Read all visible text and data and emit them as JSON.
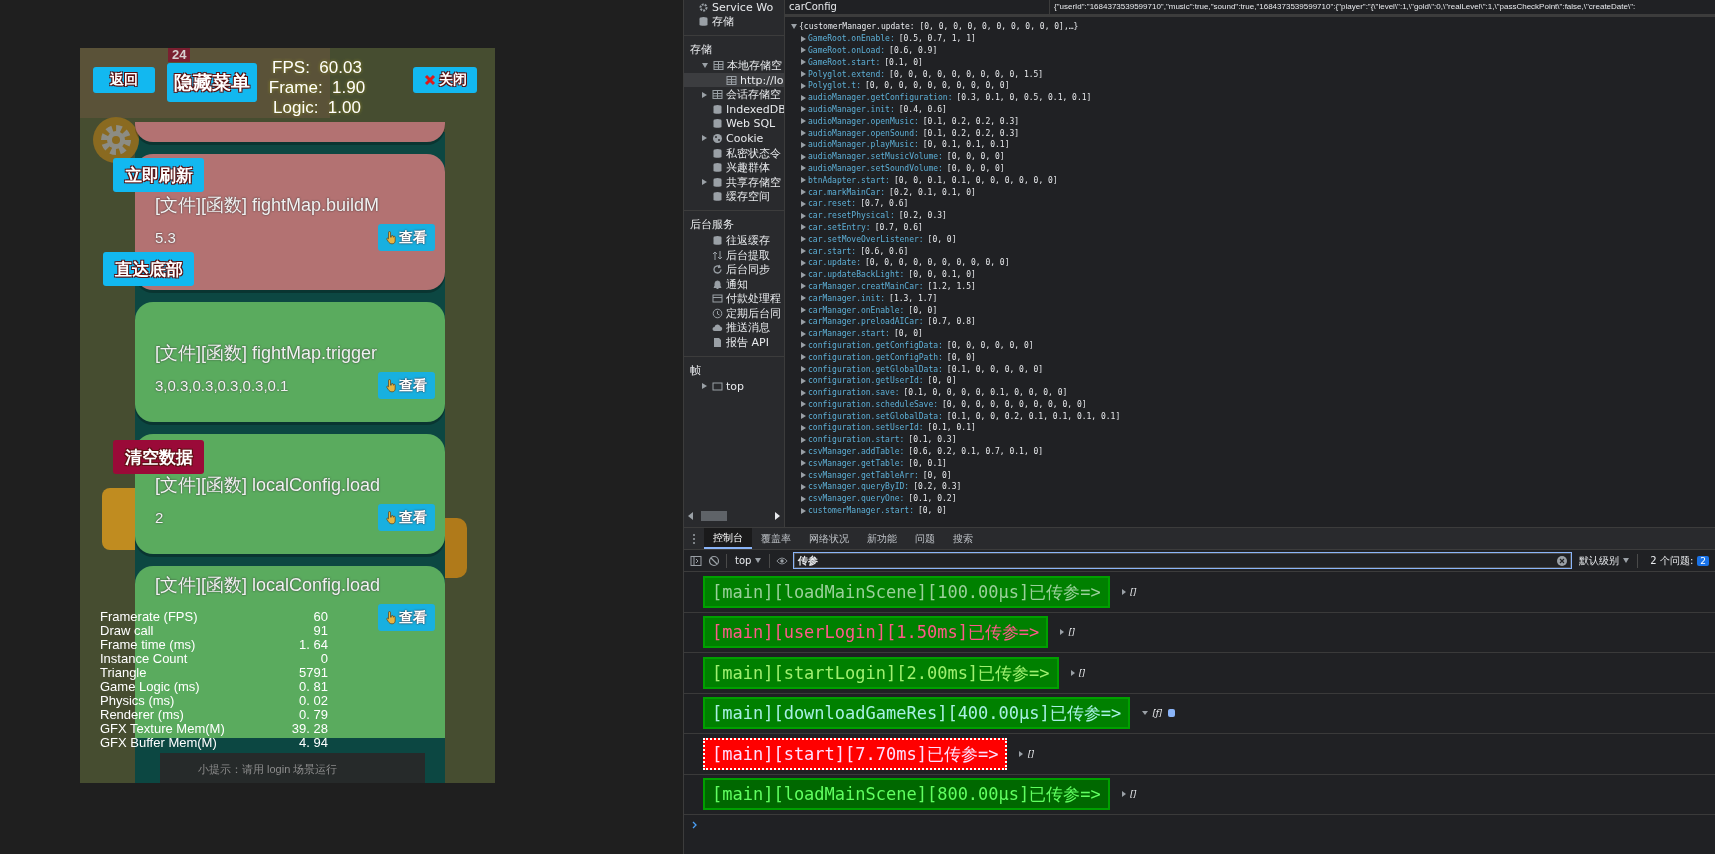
{
  "game": {
    "scene_sign": "24",
    "top_buttons": [
      {
        "label": "返回",
        "kind": "plain"
      },
      {
        "label": "隐藏菜单",
        "kind": "plain"
      },
      {
        "label": "关闭",
        "kind": "close"
      }
    ],
    "perf_lines": [
      "FPS:  60.03",
      "Frame:  1.90",
      "Logic:  1.00"
    ],
    "cards": [
      {
        "kind": "stub",
        "color": "#b37272"
      },
      {
        "kind": "entry",
        "color": "#b37272",
        "title": "[文件][函数] fightMap.buildM",
        "value": "5.3",
        "action": "查看"
      },
      {
        "kind": "entry",
        "color": "#5aab5e",
        "title": "[文件][函数] fightMap.trigger",
        "value": "3,0.3,0.3,0.3,0.3,0.1",
        "action": "查看"
      },
      {
        "kind": "entry",
        "color": "#5aab5e",
        "title": "[文件][函数] localConfig.load",
        "value": "2",
        "action": "查看"
      },
      {
        "kind": "entry",
        "color": "#5aab5e",
        "title": "[文件][函数] localConfig.load",
        "action": "查看"
      }
    ],
    "side_buttons": [
      {
        "label": "立即刷新",
        "kind": "primary"
      },
      {
        "label": "直达底部",
        "kind": "primary"
      },
      {
        "label": "清空数据",
        "kind": "danger"
      }
    ],
    "stats": [
      {
        "label": "Framerate (FPS)",
        "value": "60"
      },
      {
        "label": "Draw call",
        "value": "91"
      },
      {
        "label": "Frame time (ms)",
        "value": "1. 64"
      },
      {
        "label": "Instance Count",
        "value": "0"
      },
      {
        "label": "Triangle",
        "value": "5791"
      },
      {
        "label": "Game Logic (ms)",
        "value": "0. 81"
      },
      {
        "label": "Physics (ms)",
        "value": "0. 02"
      },
      {
        "label": "Renderer (ms)",
        "value": "0. 79"
      },
      {
        "label": "GFX Texture Mem(M)",
        "value": "39. 28"
      },
      {
        "label": "GFX Buffer Mem(M)",
        "value": "4. 94"
      }
    ],
    "hint": "小提示：请用 login 场景运行"
  },
  "devtools": {
    "sidebar": {
      "top_items": [
        {
          "label": "Service Wo",
          "kind": "gear",
          "selected": false
        },
        {
          "label": "存储",
          "kind": "database",
          "selected": false
        }
      ],
      "sections": [
        {
          "title": "存储",
          "items": [
            {
              "label": "本地存储空",
              "kind": "table",
              "selected": false,
              "expanded": true,
              "children": [
                {
                  "label": "http://lo",
                  "kind": "table",
                  "selected": true
                }
              ]
            },
            {
              "label": "会话存储空",
              "kind": "table",
              "selected": false,
              "expanded": false
            },
            {
              "label": "IndexedDB",
              "kind": "database",
              "selected": false
            },
            {
              "label": "Web SQL",
              "kind": "database",
              "selected": false
            },
            {
              "label": "Cookie",
              "kind": "cookie",
              "selected": false,
              "expanded": false
            },
            {
              "label": "私密状态令",
              "kind": "database",
              "selected": false
            },
            {
              "label": "兴趣群体",
              "kind": "database",
              "selected": false
            },
            {
              "label": "共享存储空",
              "kind": "database",
              "selected": false,
              "expanded": false
            },
            {
              "label": "缓存空间",
              "kind": "database",
              "selected": false
            }
          ]
        },
        {
          "title": "后台服务",
          "items": [
            {
              "label": "往返缓存",
              "kind": "database",
              "selected": false
            },
            {
              "label": "后台提取",
              "kind": "transfer",
              "selected": false
            },
            {
              "label": "后台同步",
              "kind": "sync",
              "selected": false
            },
            {
              "label": "通知",
              "kind": "bell",
              "selected": false
            },
            {
              "label": "付款处理程",
              "kind": "card",
              "selected": false
            },
            {
              "label": "定期后台同",
              "kind": "clock",
              "selected": false
            },
            {
              "label": "推送消息",
              "kind": "cloud",
              "selected": false
            },
            {
              "label": "报告 API",
              "kind": "file",
              "selected": false
            }
          ]
        },
        {
          "title": "帧",
          "items": [
            {
              "label": "top",
              "kind": "frame",
              "selected": false,
              "expanded": false
            }
          ]
        }
      ]
    },
    "storage_row": {
      "key": "carConfig",
      "value": "{\"userId\":\"1684373539599710\",\"music\":true,\"sound\":true,\"1684373539599710\":{\"player\":\"{\\\"level\\\":1,\\\"gold\\\":0,\\\"realLevel\\\":1,\\\"passCheckPoint\\\":false,\\\"createDate\\\":"
    },
    "tree": {
      "root": "{customerManager.update: [0, 0, 0, 0, 0, 0, 0, 0, 0, 0],…}",
      "expanded": true,
      "children": [
        {
          "key": "GameRoot.onEnable:",
          "value": "[0.5, 0.7, 1, 1]",
          "expanded": false
        },
        {
          "key": "GameRoot.onLoad:",
          "value": "[0.6, 0.9]",
          "expanded": false
        },
        {
          "key": "GameRoot.start:",
          "value": "[0.1, 0]",
          "expanded": false
        },
        {
          "key": "Polyglot.extend:",
          "value": "[0, 0, 0, 0, 0, 0, 0, 0, 0, 1.5]",
          "expanded": false
        },
        {
          "key": "Polyglot.t:",
          "value": "[0, 0, 0, 0, 0, 0, 0, 0, 0, 0]",
          "expanded": false
        },
        {
          "key": "audioManager.getConfiguration:",
          "value": "[0.3, 0.1, 0, 0.5, 0.1, 0.1]",
          "expanded": false
        },
        {
          "key": "audioManager.init:",
          "value": "[0.4, 0.6]",
          "expanded": false
        },
        {
          "key": "audioManager.openMusic:",
          "value": "[0.1, 0.2, 0.2, 0.3]",
          "expanded": false
        },
        {
          "key": "audioManager.openSound:",
          "value": "[0.1, 0.2, 0.2, 0.3]",
          "expanded": false
        },
        {
          "key": "audioManager.playMusic:",
          "value": "[0, 0.1, 0.1, 0.1]",
          "expanded": false
        },
        {
          "key": "audioManager.setMusicVolume:",
          "value": "[0, 0, 0, 0]",
          "expanded": false
        },
        {
          "key": "audioManager.setSoundVolume:",
          "value": "[0, 0, 0, 0]",
          "expanded": false
        },
        {
          "key": "btnAdapter.start:",
          "value": "[0, 0, 0.1, 0.1, 0, 0, 0, 0, 0, 0]",
          "expanded": false
        },
        {
          "key": "car.markMainCar:",
          "value": "[0.2, 0.1, 0.1, 0]",
          "expanded": false
        },
        {
          "key": "car.reset:",
          "value": "[0.7, 0.6]",
          "expanded": false
        },
        {
          "key": "car.resetPhysical:",
          "value": "[0.2, 0.3]",
          "expanded": false
        },
        {
          "key": "car.setEntry:",
          "value": "[0.7, 0.6]",
          "expanded": false
        },
        {
          "key": "car.setMoveOverListener:",
          "value": "[0, 0]",
          "expanded": false
        },
        {
          "key": "car.start:",
          "value": "[0.6, 0.6]",
          "expanded": false
        },
        {
          "key": "car.update:",
          "value": "[0, 0, 0, 0, 0, 0, 0, 0, 0, 0]",
          "expanded": false
        },
        {
          "key": "car.updateBackLight:",
          "value": "[0, 0, 0.1, 0]",
          "expanded": false
        },
        {
          "key": "carManager.creatMainCar:",
          "value": "[1.2, 1.5]",
          "expanded": false
        },
        {
          "key": "carManager.init:",
          "value": "[1.3, 1.7]",
          "expanded": false
        },
        {
          "key": "carManager.onEnable:",
          "value": "[0, 0]",
          "expanded": false
        },
        {
          "key": "carManager.preloadAICar:",
          "value": "[0.7, 0.8]",
          "expanded": false
        },
        {
          "key": "carManager.start:",
          "value": "[0, 0]",
          "expanded": false
        },
        {
          "key": "configuration.getConfigData:",
          "value": "[0, 0, 0, 0, 0, 0]",
          "expanded": false
        },
        {
          "key": "configuration.getConfigPath:",
          "value": "[0, 0]",
          "expanded": false
        },
        {
          "key": "configuration.getGlobalData:",
          "value": "[0.1, 0, 0, 0, 0, 0]",
          "expanded": false
        },
        {
          "key": "configuration.getUserId:",
          "value": "[0, 0]",
          "expanded": false
        },
        {
          "key": "configuration.save:",
          "value": "[0.1, 0, 0, 0, 0, 0.1, 0, 0, 0, 0]",
          "expanded": false
        },
        {
          "key": "configuration.scheduleSave:",
          "value": "[0, 0, 0, 0, 0, 0, 0, 0, 0, 0]",
          "expanded": false
        },
        {
          "key": "configuration.setGlobalData:",
          "value": "[0.1, 0, 0, 0.2, 0.1, 0.1, 0.1, 0.1]",
          "expanded": false
        },
        {
          "key": "configuration.setUserId:",
          "value": "[0.1, 0.1]",
          "expanded": false
        },
        {
          "key": "configuration.start:",
          "value": "[0.1, 0.3]",
          "expanded": false
        },
        {
          "key": "csvManager.addTable:",
          "value": "[0.6, 0.2, 0.1, 0.7, 0.1, 0]",
          "expanded": false
        },
        {
          "key": "csvManager.getTable:",
          "value": "[0, 0.1]",
          "expanded": false
        },
        {
          "key": "csvManager.getTableArr:",
          "value": "[0, 0]",
          "expanded": false
        },
        {
          "key": "csvManager.queryByID:",
          "value": "[0.2, 0.3]",
          "expanded": false
        },
        {
          "key": "csvManager.queryOne:",
          "value": "[0.1, 0.2]",
          "expanded": false
        },
        {
          "key": "customerManager.start:",
          "value": "[0, 0]",
          "expanded": false
        }
      ]
    },
    "drawer_tabs": [
      {
        "label": "控制台",
        "selected": true
      },
      {
        "label": "覆盖率",
        "selected": false
      },
      {
        "label": "网络状况",
        "selected": false
      },
      {
        "label": "新功能",
        "selected": false
      },
      {
        "label": "问题",
        "selected": false
      },
      {
        "label": "搜索",
        "selected": false
      }
    ],
    "toolbar": {
      "context": "top",
      "filter": "传参",
      "level": "默认级别",
      "issues": "2 个问题:",
      "issue_count": "2"
    },
    "messages": [
      {
        "text": "[main][loadMainScene][100.00µs]已传参=>",
        "kind": "muted",
        "preview": "[]",
        "expanded": false,
        "info": false
      },
      {
        "text": "[main][userLogin][1.50ms]已传参=>",
        "kind": "login",
        "preview": "[]",
        "expanded": false,
        "info": false
      },
      {
        "text": "[main][startLogin][2.00ms]已传参=>",
        "kind": "ok",
        "preview": "[]",
        "expanded": false,
        "info": false
      },
      {
        "text": "[main][downloadGameRes][400.00µs]已传参=>",
        "kind": "network",
        "preview": "[ƒ]",
        "expanded": true,
        "info": true
      },
      {
        "text": "[main][start][7.70ms]已传参=>",
        "kind": "error",
        "preview": "[]",
        "expanded": false,
        "info": false
      },
      {
        "text": "[main][loadMainScene][800.00µs]已传参=>",
        "kind": "scene",
        "preview": "[]",
        "expanded": false,
        "info": false
      }
    ]
  }
}
